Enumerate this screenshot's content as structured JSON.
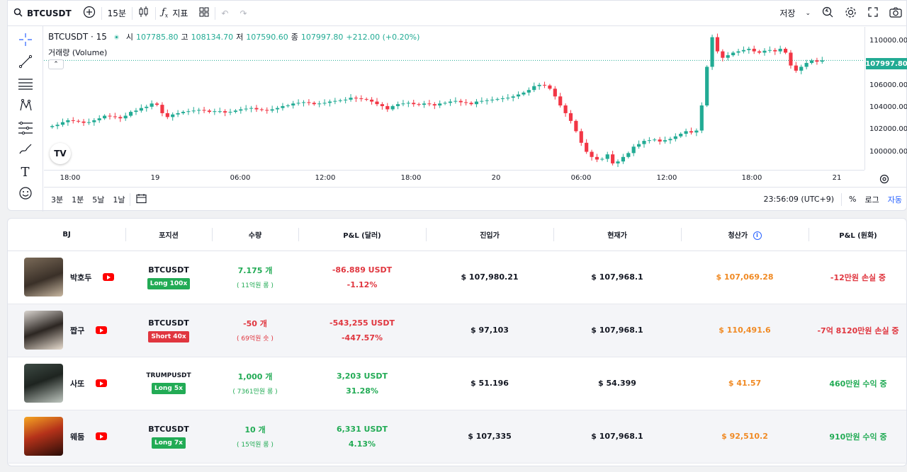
{
  "toolbar": {
    "symbol": "BTCUSDT",
    "interval": "15분",
    "indicators_label": "지표",
    "save_label": "저장"
  },
  "legend": {
    "title": "BTCUSDT · 15",
    "open_k": "시",
    "open": "107785.80",
    "high_k": "고",
    "high": "108134.70",
    "low_k": "저",
    "low": "107590.60",
    "close_k": "종",
    "close": "107997.80",
    "change": "+212.00 (+0.20%)",
    "volume": "거래량 (Volume)"
  },
  "price_axis": {
    "labels": [
      "110000.00",
      "106000.00",
      "104000.00",
      "102000.00",
      "100000.00"
    ],
    "current": "107997.80"
  },
  "time_axis": {
    "labels": [
      "18:00",
      "19",
      "06:00",
      "12:00",
      "18:00",
      "20",
      "06:00",
      "12:00",
      "18:00",
      "21"
    ]
  },
  "bottom_bar": {
    "ranges": [
      "3분",
      "1분",
      "5날",
      "1날"
    ],
    "clock": "23:56:09 (UTC+9)",
    "percent": "%",
    "log": "로그",
    "auto": "자동"
  },
  "colors": {
    "up": "#22ab94",
    "down": "#f23645",
    "profit": "#22ab55",
    "loss": "#e0363f",
    "liq": "#f08a24"
  },
  "chart_data": {
    "type": "candlestick",
    "close_series": [
      102900,
      103000,
      103200,
      103350,
      103300,
      103250,
      103150,
      103200,
      103350,
      103500,
      103700,
      103650,
      103600,
      103500,
      103700,
      104000,
      104100,
      104300,
      104400,
      104650,
      104550,
      103900,
      103600,
      103800,
      103900,
      104000,
      104050,
      104100,
      104150,
      104100,
      104000,
      104050,
      104050,
      103950,
      104000,
      104100,
      104200,
      104250,
      104300,
      104200,
      104150,
      104100,
      104200,
      104300,
      104450,
      104500,
      104650,
      104700,
      104750,
      104700,
      104600,
      104650,
      104700,
      104800,
      104850,
      104900,
      104950,
      105100,
      105050,
      105000,
      104950,
      104800,
      104600,
      104450,
      104200,
      104450,
      104600,
      104650,
      104700,
      104600,
      104550,
      104650,
      104600,
      104500,
      104650,
      104700,
      104800,
      104850,
      104750,
      104700,
      104600,
      104800,
      104850,
      104900,
      104950,
      105000,
      105050,
      105100,
      105200,
      105350,
      105500,
      105700,
      106000,
      106100,
      106050,
      105800,
      105200,
      104500,
      103900,
      103300,
      102500,
      101600,
      100900,
      100500,
      100300,
      100350,
      100700,
      100000,
      100150,
      100500,
      100800,
      101300,
      101500,
      101750,
      101800,
      101850,
      101700,
      101800,
      101900,
      102100,
      102300,
      102500,
      102400,
      102550,
      104500,
      107500,
      109800,
      108700,
      108200,
      108400,
      108600,
      108700,
      108800,
      108900,
      108700,
      108600,
      108750,
      108800,
      108700,
      108900,
      108600,
      107600,
      107200,
      107500,
      107800,
      108000,
      107900,
      108000
    ],
    "xlabel": "",
    "ylabel": "",
    "ylim": [
      99500,
      110600
    ]
  },
  "table": {
    "headers": [
      "BJ",
      "포지션",
      "수량",
      "P&L (달러)",
      "진입가",
      "현재가",
      "청산가",
      "P&L (원화)"
    ],
    "rows": [
      {
        "name": "박호두",
        "symbol": "BTCUSDT",
        "side": "Long 100x",
        "qty": "7.175 개",
        "qty_krw": "( 11억원 롱 )",
        "pnl_usd": "-86.889 USDT",
        "pnl_pct": "-1.12%",
        "entry": "$ 107,980.21",
        "current": "$ 107,968.1",
        "liq": "$ 107,069.28",
        "pnl_krw": "-12만원 손실 중"
      },
      {
        "name": "짭구",
        "symbol": "BTCUSDT",
        "side": "Short 40x",
        "qty": "-50 개",
        "qty_krw": "( 69억원 숏 )",
        "pnl_usd": "-543,255 USDT",
        "pnl_pct": "-447.57%",
        "entry": "$ 97,103",
        "current": "$ 107,968.1",
        "liq": "$ 110,491.6",
        "pnl_krw": "-7억 8120만원 손실 중"
      },
      {
        "name": "사또",
        "symbol": "TRUMPUSDT",
        "side": "Long 5x",
        "qty": "1,000 개",
        "qty_krw": "( 7361만원 롱 )",
        "pnl_usd": "3,203 USDT",
        "pnl_pct": "31.28%",
        "entry": "$ 51.196",
        "current": "$ 54.399",
        "liq": "$ 41.57",
        "pnl_krw": "460만원 수익 중"
      },
      {
        "name": "웨둠",
        "symbol": "BTCUSDT",
        "side": "Long 7x",
        "qty": "10 개",
        "qty_krw": "( 15억원 롱 )",
        "pnl_usd": "6,331 USDT",
        "pnl_pct": "4.13%",
        "entry": "$ 107,335",
        "current": "$ 107,968.1",
        "liq": "$ 92,510.2",
        "pnl_krw": "910만원 수익 중"
      }
    ]
  }
}
